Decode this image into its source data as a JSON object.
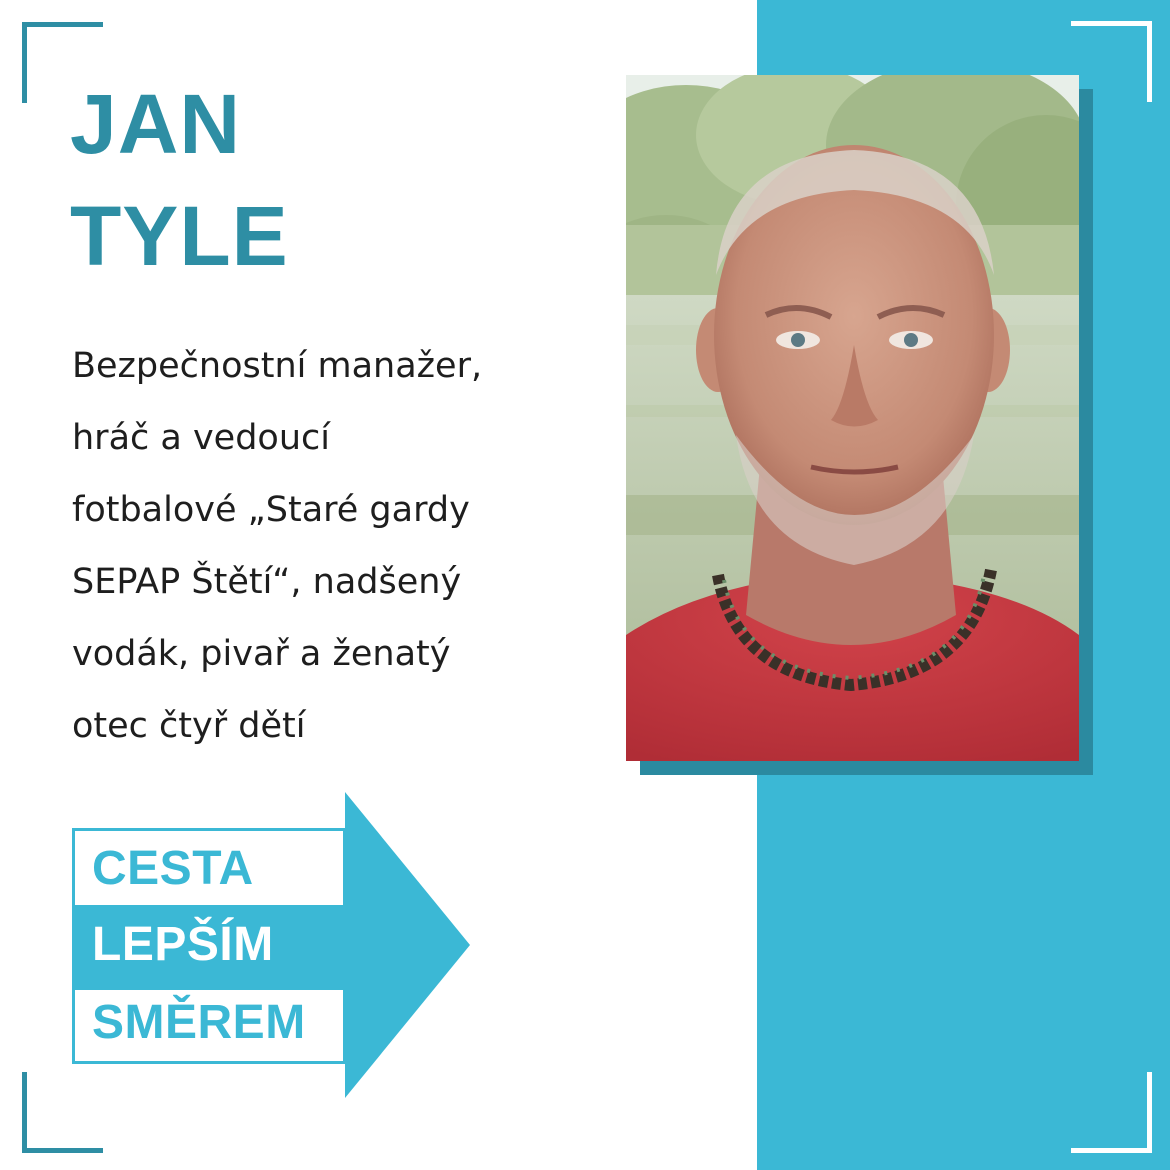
{
  "colors": {
    "accent": "#2e8ea4",
    "panel": "#3bb8d5",
    "text": "#1e1e1e",
    "background": "#ffffff"
  },
  "person": {
    "first_name": "JAN",
    "last_name": "TYLE"
  },
  "bio": {
    "lines": [
      "Bezpečnostní manažer,",
      "hráč a vedoucí",
      "fotbalové „Staré gardy",
      "SEPAP Štětí“, nadšený",
      "vodák, pivař a ženatý",
      "otec čtyř dětí"
    ]
  },
  "slogan": {
    "lines": [
      "CESTA",
      "LEPŠÍM",
      "SMĚREM"
    ]
  },
  "photo": {
    "subject": "portrait photo of a man in red shirt by a lake"
  }
}
